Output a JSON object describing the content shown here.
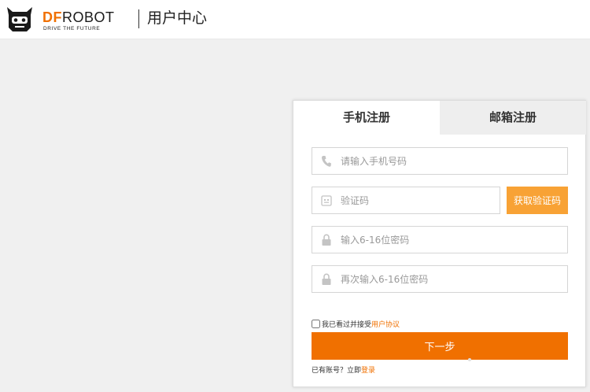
{
  "header": {
    "brand_df": "DF",
    "brand_robot": "ROBOT",
    "tagline": "DRIVE THE FUTURE",
    "title": "用户中心"
  },
  "tabs": [
    {
      "label": "手机注册",
      "active": true
    },
    {
      "label": "邮箱注册",
      "active": false
    }
  ],
  "form": {
    "phone_placeholder": "请输入手机号码",
    "code_placeholder": "验证码",
    "get_code_label": "获取验证码",
    "password_placeholder": "输入6-16位密码",
    "password_confirm_placeholder": "再次输入6-16位密码",
    "agree_text": "我已看过并接受",
    "agreement_link": "用户协议",
    "next_label": "下一步",
    "have_account_text": "已有账号？立即",
    "login_link": "登录"
  },
  "colors": {
    "accent": "#f07000",
    "get_code_button": "#f8a235",
    "page_background": "#f0f0f0"
  },
  "icons": [
    "robot-logo-icon",
    "phone-icon",
    "code-icon",
    "lock-icon",
    "lock-icon"
  ]
}
